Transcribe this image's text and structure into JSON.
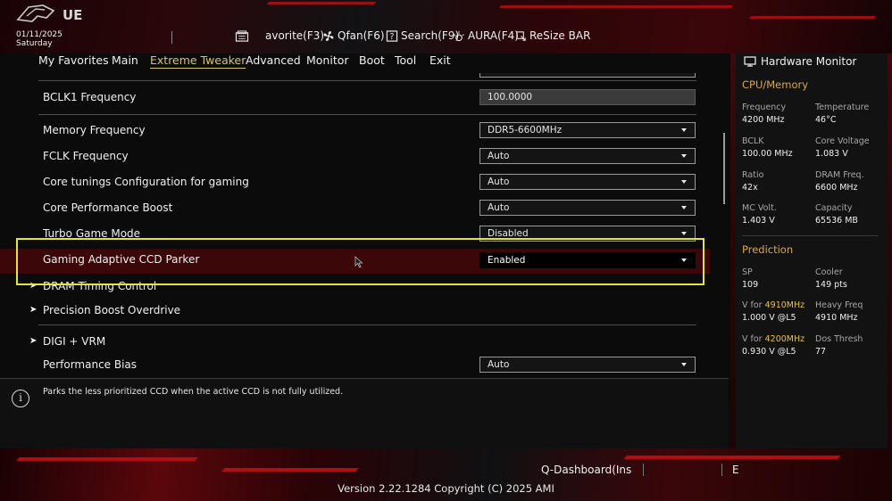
{
  "header": {
    "brand_text": "UE",
    "date": "01/11/2025",
    "day": "Saturday",
    "buttons": [
      {
        "label": "avorite(F3)",
        "icon": "my-favorite-icon"
      },
      {
        "label": "Qfan(F6)",
        "icon": "fan-icon"
      },
      {
        "label": "Search(F9)",
        "icon": "search-help-icon"
      },
      {
        "label": "AURA(F4)",
        "icon": "aura-light-icon"
      },
      {
        "label": "ReSize BAR",
        "icon": "resize-bar-icon"
      }
    ]
  },
  "menu": {
    "items": [
      "My Favorites",
      "Main",
      "Extreme Tweaker",
      "Advanced",
      "Monitor",
      "Boot",
      "Tool",
      "Exit"
    ],
    "active": "Extreme Tweaker"
  },
  "settings": {
    "bclk1": {
      "label": "BCLK1 Frequency",
      "value": "100.0000"
    },
    "memory_freq": {
      "label": "Memory Frequency",
      "value": "DDR5-6600MHz"
    },
    "fclk_freq": {
      "label": "FCLK Frequency",
      "value": "Auto"
    },
    "core_tunings": {
      "label": "Core tunings Configuration for gaming",
      "value": "Auto"
    },
    "core_perf_boost": {
      "label": "Core Performance Boost",
      "value": "Auto"
    },
    "turbo_game_mode": {
      "label": "Turbo Game Mode",
      "value": "Disabled"
    },
    "gaming_ccd_parker": {
      "label": "Gaming Adaptive CCD Parker",
      "value": "Enabled"
    },
    "dram_timing": {
      "label": "DRAM Timing Control"
    },
    "pbo": {
      "label": "Precision Boost Overdrive"
    },
    "digi_vrm": {
      "label": "DIGI + VRM"
    },
    "performance_bias": {
      "label": "Performance Bias",
      "value": "Auto"
    }
  },
  "help_text": "Parks the less prioritized CCD when the active CCD is not fully utilized.",
  "hardware_monitor": {
    "title": "Hardware Monitor",
    "cpu_memory": {
      "title": "CPU/Memory",
      "frequency_label": "Frequency",
      "frequency": "4200 MHz",
      "temperature_label": "Temperature",
      "temperature": "46°C",
      "bclk_label": "BCLK",
      "bclk": "100.00 MHz",
      "core_voltage_label": "Core Voltage",
      "core_voltage": "1.083 V",
      "ratio_label": "Ratio",
      "ratio": "42x",
      "dram_freq_label": "DRAM Freq.",
      "dram_freq": "6600 MHz",
      "mc_volt_label": "MC Volt.",
      "mc_volt": "1.403 V",
      "capacity_label": "Capacity",
      "capacity": "65536 MB"
    },
    "prediction": {
      "title": "Prediction",
      "sp_label": "SP",
      "sp": "109",
      "cooler_label": "Cooler",
      "cooler": "149 pts",
      "v_for_prefix_1": "V for ",
      "v_for_freq_1": "4910MHz",
      "v_for_value_1": "1.000 V @L5",
      "heavy_freq_label": "Heavy Freq",
      "heavy_freq": "4910 MHz",
      "v_for_prefix_2": "V for ",
      "v_for_freq_2": "4200MHz",
      "v_for_value_2": "0.930 V @L5",
      "dos_thresh_label": "Dos Thresh",
      "dos_thresh": "77"
    }
  },
  "footer": {
    "qdashboard": "Q-Dashboard(Ins",
    "e_label": "E",
    "version": "Version 2.22.1284 Copyright (C) 2025 AMI"
  },
  "colors": {
    "accent_gold": "#d7c46a",
    "highlight_row": "#3c0709",
    "focus_box": "#e8e33c",
    "section_title": "#d7a84a"
  }
}
